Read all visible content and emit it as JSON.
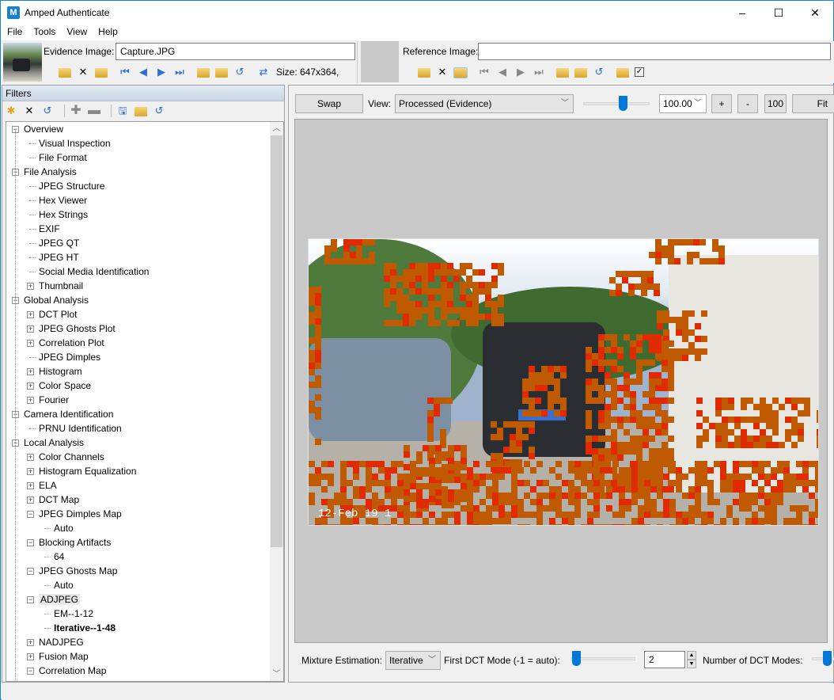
{
  "window": {
    "title": "Amped Authenticate",
    "controls": {
      "minimize": "–",
      "maximize": "☐",
      "close": "✕"
    }
  },
  "menu": [
    "File",
    "Tools",
    "View",
    "Help"
  ],
  "evidence": {
    "label": "Evidence Image:",
    "filename": "Capture.JPG",
    "size_text": "Size: 647x364,",
    "toolbar_icons": [
      "open-folder-icon",
      "close-icon",
      "export-icon",
      "first-icon",
      "previous-icon",
      "next-icon",
      "last-icon",
      "export-folder-icon",
      "remove-folder-icon",
      "reload-icon",
      "swap-icon"
    ]
  },
  "reference": {
    "label": "Reference Image:",
    "filename": "",
    "toolbar_icons": [
      "open-folder-icon",
      "close-icon",
      "export-icon",
      "first-icon",
      "previous-icon",
      "next-icon",
      "last-icon",
      "export-folder-icon",
      "remove-folder-icon",
      "reload-icon",
      "copy-icon",
      "checkbox-icon"
    ]
  },
  "filters": {
    "header": "Filters",
    "toolbar_icons": [
      "new-icon",
      "delete-icon",
      "reset-icon",
      "add-icon",
      "remove-icon",
      "save-icon",
      "open-icon",
      "refresh-icon"
    ],
    "tree": [
      {
        "label": "Overview",
        "level": 0,
        "expander": "minus"
      },
      {
        "label": "Visual Inspection",
        "level": 1,
        "expander": "none"
      },
      {
        "label": "File Format",
        "level": 1,
        "expander": "none"
      },
      {
        "label": "File Analysis",
        "level": 0,
        "expander": "minus"
      },
      {
        "label": "JPEG Structure",
        "level": 1,
        "expander": "none"
      },
      {
        "label": "Hex Viewer",
        "level": 1,
        "expander": "none"
      },
      {
        "label": "Hex Strings",
        "level": 1,
        "expander": "none"
      },
      {
        "label": "EXIF",
        "level": 1,
        "expander": "none"
      },
      {
        "label": "JPEG QT",
        "level": 1,
        "expander": "none"
      },
      {
        "label": "JPEG HT",
        "level": 1,
        "expander": "none"
      },
      {
        "label": "Social Media Identification",
        "level": 1,
        "expander": "none"
      },
      {
        "label": "Thumbnail",
        "level": 1,
        "expander": "plus"
      },
      {
        "label": "Global Analysis",
        "level": 0,
        "expander": "minus"
      },
      {
        "label": "DCT Plot",
        "level": 1,
        "expander": "plus"
      },
      {
        "label": "JPEG Ghosts Plot",
        "level": 1,
        "expander": "plus"
      },
      {
        "label": "Correlation Plot",
        "level": 1,
        "expander": "plus"
      },
      {
        "label": "JPEG Dimples",
        "level": 1,
        "expander": "none"
      },
      {
        "label": "Histogram",
        "level": 1,
        "expander": "plus"
      },
      {
        "label": "Color Space",
        "level": 1,
        "expander": "plus"
      },
      {
        "label": "Fourier",
        "level": 1,
        "expander": "plus"
      },
      {
        "label": "Camera Identification",
        "level": 0,
        "expander": "minus"
      },
      {
        "label": "PRNU Identification",
        "level": 1,
        "expander": "none"
      },
      {
        "label": "Local Analysis",
        "level": 0,
        "expander": "minus"
      },
      {
        "label": "Color Channels",
        "level": 1,
        "expander": "plus"
      },
      {
        "label": "Histogram Equalization",
        "level": 1,
        "expander": "plus"
      },
      {
        "label": "ELA",
        "level": 1,
        "expander": "plus"
      },
      {
        "label": "DCT Map",
        "level": 1,
        "expander": "plus"
      },
      {
        "label": "JPEG Dimples Map",
        "level": 1,
        "expander": "minus"
      },
      {
        "label": "Auto",
        "level": 2,
        "expander": "none"
      },
      {
        "label": "Blocking Artifacts",
        "level": 1,
        "expander": "minus"
      },
      {
        "label": "64",
        "level": 2,
        "expander": "none"
      },
      {
        "label": "JPEG Ghosts Map",
        "level": 1,
        "expander": "minus"
      },
      {
        "label": "Auto",
        "level": 2,
        "expander": "none"
      },
      {
        "label": "ADJPEG",
        "level": 1,
        "expander": "minus",
        "highlighted": true
      },
      {
        "label": "EM--1-12",
        "level": 2,
        "expander": "none"
      },
      {
        "label": "Iterative--1-48",
        "level": 2,
        "expander": "none",
        "bold": true
      },
      {
        "label": "NADJPEG",
        "level": 1,
        "expander": "plus"
      },
      {
        "label": "Fusion Map",
        "level": 1,
        "expander": "plus"
      },
      {
        "label": "Correlation Map",
        "level": 1,
        "expander": "minus"
      }
    ]
  },
  "viewer": {
    "swap_label": "Swap",
    "view_label": "View:",
    "view_value": "Processed (Evidence)",
    "zoom_slider_fraction": 0.6,
    "zoom_value": "100.00",
    "zoom_in_label": "+",
    "zoom_out_label": "-",
    "zoom_100_label": "100",
    "fit_label": "Fit",
    "image_overlay_text": "12-Feb 19 1"
  },
  "params": {
    "mixture_label": "Mixture Estimation:",
    "mixture_value": "Iterative",
    "first_dct_label": "First DCT Mode (-1 = auto):",
    "first_dct_slider_fraction": 0.05,
    "first_dct_value": "2",
    "num_dct_label": "Number of DCT Modes:"
  },
  "colors": {
    "accent": "#0078d7",
    "overlay_orange": "#c05a00",
    "overlay_red": "#e02a00"
  }
}
